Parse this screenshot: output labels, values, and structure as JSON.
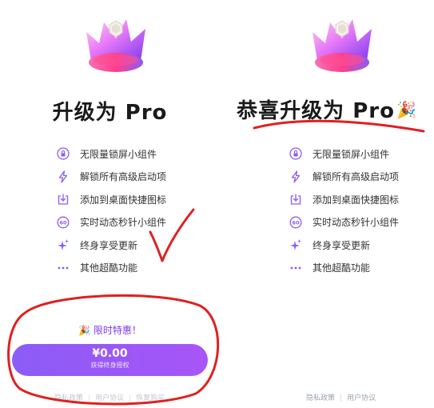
{
  "left": {
    "title": "升级为 Pro",
    "features": [
      {
        "icon": "lock-icon",
        "label": "无限量锁屏小组件"
      },
      {
        "icon": "lightning-icon",
        "label": "解锁所有高级启动项"
      },
      {
        "icon": "download-icon",
        "label": "添加到桌面快捷图标"
      },
      {
        "icon": "timer-60-icon",
        "label": "实时动态秒针小组件"
      },
      {
        "icon": "sparkle-icon",
        "label": "终身享受更新"
      },
      {
        "icon": "more-dots-icon",
        "label": "其他超酷功能"
      }
    ],
    "promo": "🎉 限时特惠！",
    "price": "¥0.00",
    "price_sub": "获得终身授权",
    "links": [
      "隐私政策",
      "用户协议",
      "恢复购买"
    ]
  },
  "right": {
    "title": "恭喜升级为 Pro",
    "title_emoji": "🎉",
    "features": [
      {
        "icon": "lock-icon",
        "label": "无限量锁屏小组件"
      },
      {
        "icon": "lightning-icon",
        "label": "解锁所有高级启动项"
      },
      {
        "icon": "download-icon",
        "label": "添加到桌面快捷图标"
      },
      {
        "icon": "timer-60-icon",
        "label": "实时动态秒针小组件"
      },
      {
        "icon": "sparkle-icon",
        "label": "终身享受更新"
      },
      {
        "icon": "more-dots-icon",
        "label": "其他超酷功能"
      }
    ],
    "links": [
      "隐私政策",
      "用户协议"
    ]
  },
  "colors": {
    "accent": "#8b5cf6",
    "annotation_red": "#e02020"
  }
}
